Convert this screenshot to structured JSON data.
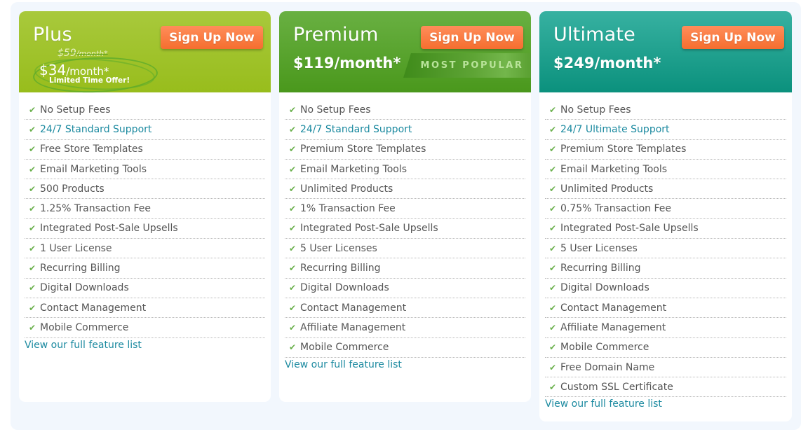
{
  "plans": [
    {
      "name": "Plus",
      "old_price": "$59",
      "old_price_period": "/month*",
      "price": "$34",
      "price_period": "/month*",
      "promo": "Limited Time Offer!",
      "signup_label": "Sign Up Now",
      "header_color": "#a1c42a",
      "features": [
        {
          "label": "No Setup Fees",
          "link": false
        },
        {
          "label": "24/7 Standard Support",
          "link": true
        },
        {
          "label": "Free Store Templates",
          "link": false
        },
        {
          "label": "Email Marketing Tools",
          "link": false
        },
        {
          "label": "500 Products",
          "link": false
        },
        {
          "label": "1.25% Transaction Fee",
          "link": false
        },
        {
          "label": "Integrated Post-Sale Upsells",
          "link": false
        },
        {
          "label": "1 User License",
          "link": false
        },
        {
          "label": "Recurring Billing",
          "link": false
        },
        {
          "label": "Digital Downloads",
          "link": false
        },
        {
          "label": "Contact Management",
          "link": false
        },
        {
          "label": "Mobile Commerce",
          "link": false
        }
      ],
      "view_link": "View our full feature list"
    },
    {
      "name": "Premium",
      "price": "$119/month*",
      "badge": "MOST POPULAR",
      "signup_label": "Sign Up Now",
      "header_color": "#56a22c",
      "features": [
        {
          "label": "No Setup Fees",
          "link": false
        },
        {
          "label": "24/7 Standard Support",
          "link": true
        },
        {
          "label": "Premium Store Templates",
          "link": false
        },
        {
          "label": "Email Marketing Tools",
          "link": false
        },
        {
          "label": "Unlimited Products",
          "link": false
        },
        {
          "label": "1% Transaction Fee",
          "link": false
        },
        {
          "label": "Integrated Post-Sale Upsells",
          "link": false
        },
        {
          "label": "5 User Licenses",
          "link": false
        },
        {
          "label": "Recurring Billing",
          "link": false
        },
        {
          "label": "Digital Downloads",
          "link": false
        },
        {
          "label": "Contact Management",
          "link": false
        },
        {
          "label": "Affiliate Management",
          "link": false
        },
        {
          "label": "Mobile Commerce",
          "link": false
        }
      ],
      "view_link": "View our full feature list"
    },
    {
      "name": "Ultimate",
      "price": "$249/month*",
      "signup_label": "Sign Up Now",
      "header_color": "#1fa290",
      "features": [
        {
          "label": "No Setup Fees",
          "link": false
        },
        {
          "label": "24/7 Ultimate Support",
          "link": true
        },
        {
          "label": "Premium Store Templates",
          "link": false
        },
        {
          "label": "Email Marketing Tools",
          "link": false
        },
        {
          "label": "Unlimited Products",
          "link": false
        },
        {
          "label": "0.75% Transaction Fee",
          "link": false
        },
        {
          "label": "Integrated Post-Sale Upsells",
          "link": false
        },
        {
          "label": "5 User Licenses",
          "link": false
        },
        {
          "label": "Recurring Billing",
          "link": false
        },
        {
          "label": "Digital Downloads",
          "link": false
        },
        {
          "label": "Contact Management",
          "link": false
        },
        {
          "label": "Affiliate Management",
          "link": false
        },
        {
          "label": "Mobile Commerce",
          "link": false
        },
        {
          "label": "Free Domain Name",
          "link": false
        },
        {
          "label": "Custom SSL Certificate",
          "link": false
        }
      ],
      "view_link": "View our full feature list"
    }
  ],
  "colors": {
    "signup_button": "#f7773b",
    "link": "#1c8aa0",
    "check": "#6ab04c",
    "panel_background": "#f2f7fd"
  },
  "icons": {
    "check": "✔"
  }
}
